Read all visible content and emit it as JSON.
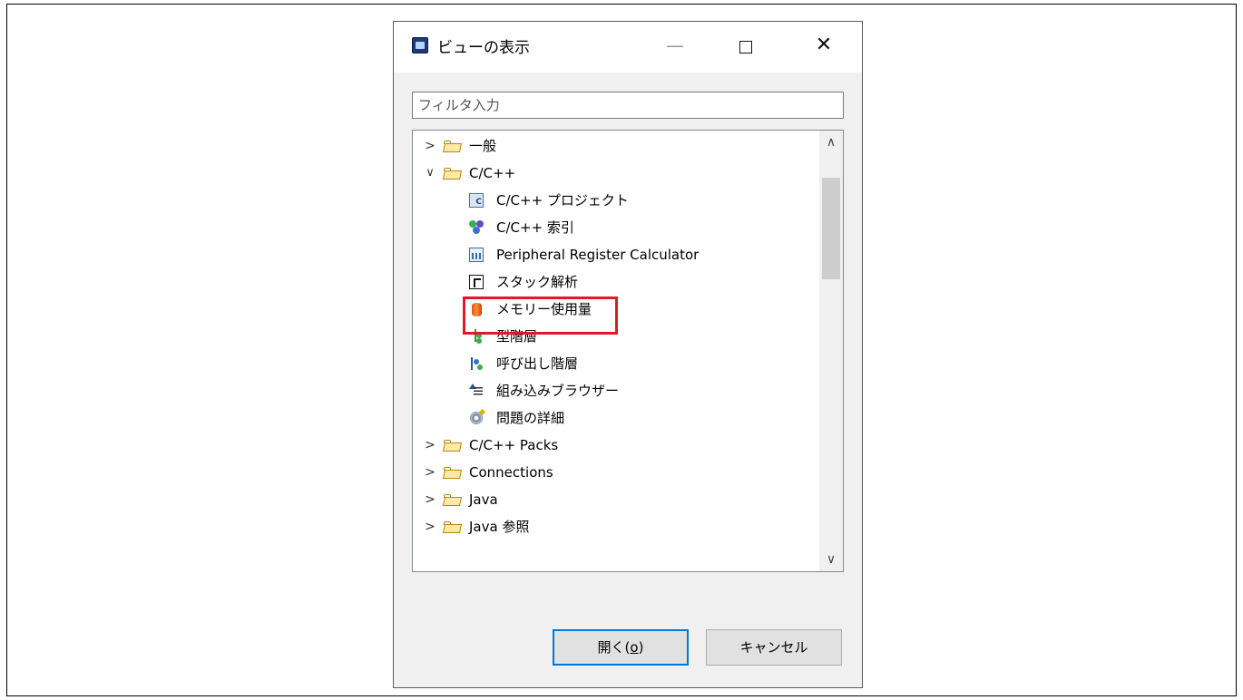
{
  "dialog": {
    "title": "ビューの表示",
    "window_controls": {
      "minimize": "—",
      "close": "✕"
    }
  },
  "filter": {
    "placeholder": "フィルタ入力",
    "value": ""
  },
  "tree": {
    "highlighted_item": "メモリー使用量",
    "highlight_color": "#e0182a",
    "items": [
      {
        "label": "一般",
        "type": "folder",
        "expanded": false
      },
      {
        "label": "C/C++",
        "type": "folder",
        "expanded": true
      },
      {
        "label": "C/C++ プロジェクト",
        "type": "view",
        "icon": "project-icon"
      },
      {
        "label": "C/C++ 索引",
        "type": "view",
        "icon": "index-icon"
      },
      {
        "label": "Peripheral Register Calculator",
        "type": "view",
        "icon": "calculator-icon"
      },
      {
        "label": "スタック解析",
        "type": "view",
        "icon": "stack-analysis-icon"
      },
      {
        "label": "メモリー使用量",
        "type": "view",
        "icon": "memory-usage-icon"
      },
      {
        "label": "型階層",
        "type": "view",
        "icon": "type-hierarchy-icon"
      },
      {
        "label": "呼び出し階層",
        "type": "view",
        "icon": "call-hierarchy-icon"
      },
      {
        "label": "組み込みブラウザー",
        "type": "view",
        "icon": "include-browser-icon"
      },
      {
        "label": "問題の詳細",
        "type": "view",
        "icon": "problem-details-icon"
      },
      {
        "label": "C/C++ Packs",
        "type": "folder",
        "expanded": false
      },
      {
        "label": "Connections",
        "type": "folder",
        "expanded": false
      },
      {
        "label": "Java",
        "type": "folder",
        "expanded": false
      },
      {
        "label": "Java 参照",
        "type": "folder",
        "expanded": false
      }
    ]
  },
  "buttons": {
    "open_prefix": "開く(",
    "open_mnemonic": "o",
    "open_suffix": ")",
    "cancel": "キャンセル"
  },
  "colors": {
    "focus_border": "#0078d7",
    "folder": "#ffe9a6"
  }
}
